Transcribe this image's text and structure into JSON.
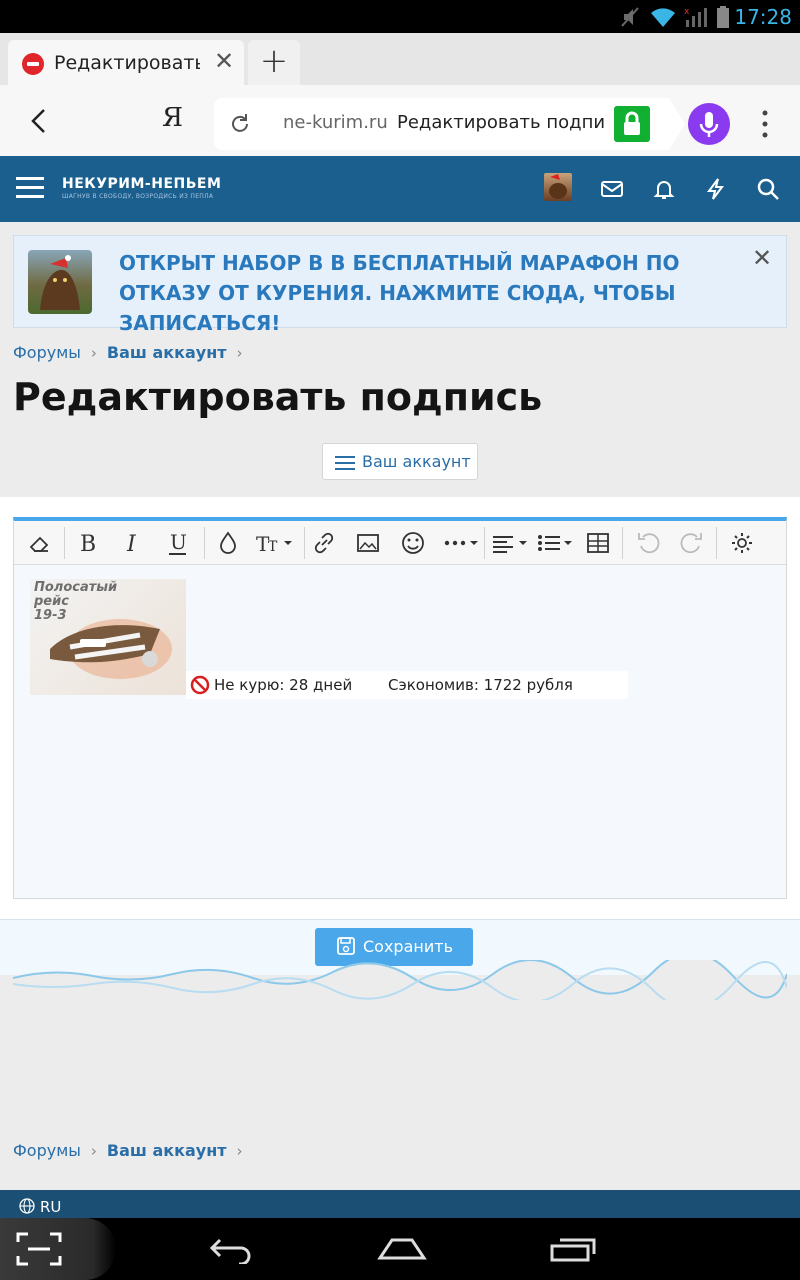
{
  "status_bar": {
    "time": "17:28"
  },
  "browser": {
    "tab": {
      "title": "Редактировать подпись"
    },
    "address": {
      "domain": "ne-kurim.ru",
      "page_title": "Редактировать подпис"
    },
    "search_engine_glyph": "Я"
  },
  "site": {
    "logo": {
      "main": "НЕКУРИМ-НЕПЬЕМ",
      "tagline": "ШАГНУВ В СВОБОДУ, ВОЗРОДИСЬ ИЗ ПЕПЛА"
    }
  },
  "notice": {
    "text": "ОТКРЫТ НАБОР В В БЕСПЛАТНЫЙ МАРАФОН ПО ОТКАЗУ ОТ КУРЕНИЯ. НАЖМИТЕ СЮДА, ЧТОБЫ ЗАПИСАТЬСЯ!"
  },
  "breadcrumb": {
    "item1": "Форумы",
    "item2": "Ваш аккаунт"
  },
  "page": {
    "title": "Редактировать подпись",
    "account_button": "Ваш аккаунт"
  },
  "editor": {
    "signature": {
      "image_caption_line1": "Полосатый",
      "image_caption_line2": "рейс",
      "image_caption_line3": "19-3",
      "not_smoking": "Не курю: 28 дней",
      "saved": "Сэкономив: 1722 рубля"
    }
  },
  "save_button": "Сохранить",
  "footer": {
    "language": "RU"
  },
  "colors": {
    "header": "#1b5f8f",
    "accent": "#49a7ea",
    "link": "#2a6ea8",
    "notice_text": "#2a79bd"
  }
}
